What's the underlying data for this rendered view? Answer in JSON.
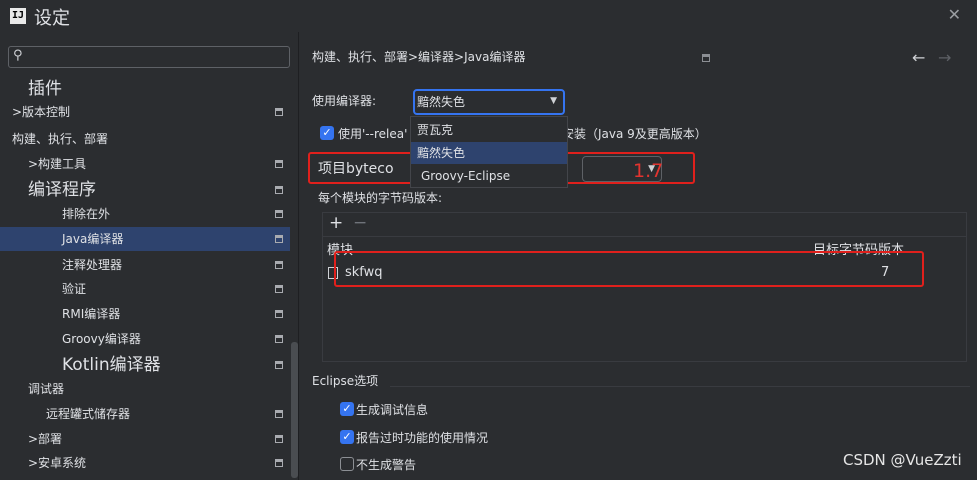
{
  "window": {
    "logo_text": "IJ",
    "title": "设定",
    "close_glyph": "✕"
  },
  "sidebar": {
    "search": {
      "value": "",
      "placeholder": ""
    },
    "items": [
      {
        "label": "插件"
      },
      {
        "label": ">版本控制"
      },
      {
        "label": "构建、执行、部署"
      },
      {
        "label": ">构建工具"
      },
      {
        "label": "编译程序"
      },
      {
        "label": "排除在外"
      },
      {
        "label": "Java编译器",
        "selected": true
      },
      {
        "label": "注释处理器"
      },
      {
        "label": "验证"
      },
      {
        "label": "RMI编译器"
      },
      {
        "label": "Groovy编译器"
      },
      {
        "label": "Kotlin编译器"
      },
      {
        "label": "调试器"
      },
      {
        "label": "远程罐式储存器"
      },
      {
        "label": ">部署"
      },
      {
        "label": ">安卓系统"
      }
    ]
  },
  "main": {
    "breadcrumb": "构建、执行、部署>编译器>Java编译器",
    "nav_back": "←",
    "nav_forward": "→",
    "use_compiler_label": "使用编译器:",
    "compiler_selected": "黯然失色",
    "release_option": {
      "checked": true,
      "label_before": "使用'--relea'",
      "label_after": "安装（Java 9及更高版本）"
    },
    "dropdown_options": [
      "贾瓦克",
      "黯然失色",
      "Groovy-Eclipse"
    ],
    "project_bytecode_label": "项目byteco",
    "project_bytecode_value": "1.7",
    "per_module_label": "每个模块的字节码版本:",
    "table": {
      "add_glyph": "+",
      "remove_glyph": "−",
      "col_module": "模块",
      "col_target": "目标字节码版本",
      "rows": [
        {
          "module": "skfwq",
          "target": "7"
        }
      ]
    },
    "eclipse_section_title": "Eclipse选项",
    "eclipse_options": [
      {
        "label": "生成调试信息",
        "checked": true
      },
      {
        "label": "报告过时功能的使用情况",
        "checked": true
      },
      {
        "label": "不生成警告",
        "checked": false
      }
    ]
  },
  "watermark": "CSDN @VueZzti",
  "colors": {
    "background": "#2b2d30",
    "selection": "#2e436e",
    "accent": "#3574f0",
    "annotation_red": "#e0201c"
  }
}
